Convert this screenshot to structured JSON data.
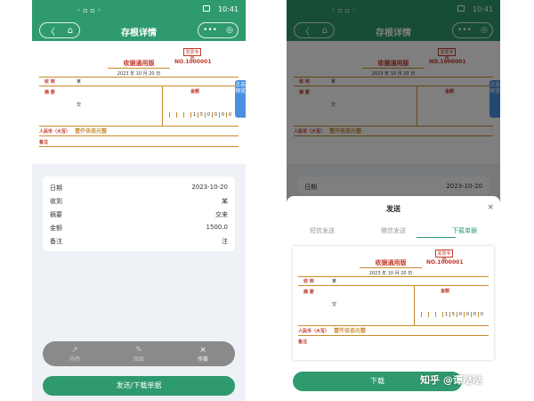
{
  "status": {
    "sys": "◦ ▫ ▫ ◦",
    "time": "10:41"
  },
  "nav": {
    "title": "存根详情",
    "back": "〈",
    "home": "⌂",
    "more": "•••",
    "target": "◎"
  },
  "receipt": {
    "title": "收据通用版",
    "date": "2023 年 10 月 20 日",
    "stamp_text": "发票专用",
    "number": "NO.1000001",
    "label_receive": "收 到",
    "receive_value": "某",
    "label_summary": "摘 要",
    "summary_value": "交",
    "label_amount": "金额",
    "digits": [
      "",
      "",
      "",
      "",
      "1",
      "5",
      "0",
      "0",
      "0",
      "0"
    ],
    "label_rmb": "人民币（大写）",
    "rmb_value": "壹仟伍佰元整",
    "label_note": "备注"
  },
  "side_tab": "点击预览",
  "info": {
    "date": {
      "label": "日期",
      "value": "2023-10-20"
    },
    "receive": {
      "label": "收到",
      "value": "某"
    },
    "summary": {
      "label": "摘要",
      "value": "交来"
    },
    "amount": {
      "label": "金额",
      "value": "1500.0"
    },
    "note": {
      "label": "备注",
      "value": "注"
    }
  },
  "toolbar": {
    "items": [
      {
        "label": "内传",
        "icon": "↗"
      },
      {
        "label": "回显",
        "icon": "✎"
      },
      {
        "label": "作废",
        "icon": "⨯"
      }
    ]
  },
  "primary_button": "发送/下载单据",
  "sheet": {
    "title": "发送",
    "close": "×",
    "tabs": [
      "短信发送",
      "微信发送",
      "下载单据"
    ],
    "download": "下载"
  },
  "watermark": "知乎 @谭哒哒",
  "colors": {
    "brand_green": "#2e9a6e",
    "stamp_red": "#c0392b"
  }
}
